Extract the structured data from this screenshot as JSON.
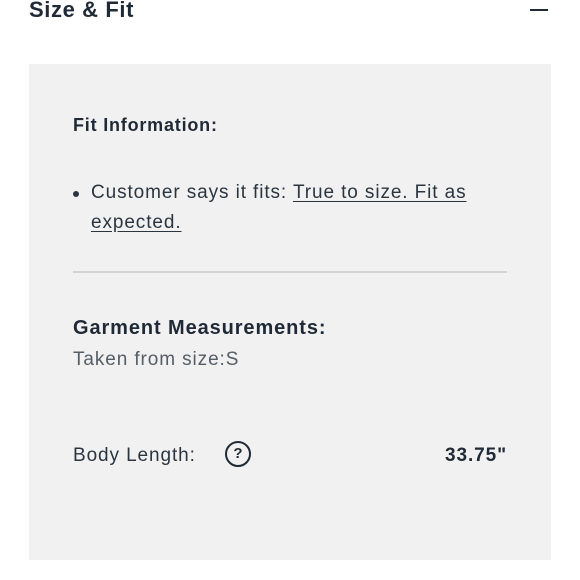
{
  "section": {
    "title": "Size & Fit",
    "collapse_icon": "minus-icon"
  },
  "fit_information": {
    "heading": "Fit Information:",
    "items": [
      {
        "prefix": "Customer says it fits: ",
        "link_text": "True to size. Fit as expected."
      }
    ]
  },
  "garment_measurements": {
    "heading": "Garment Measurements:",
    "subtitle": "Taken from size:S",
    "rows": [
      {
        "label": "Body Length:",
        "help_icon": "question-circle-icon",
        "help_glyph": "?",
        "value": "33.75\""
      }
    ]
  },
  "colors": {
    "text": "#1f2a36",
    "panel_bg": "#f1f1f1",
    "divider": "#d3d3d3"
  }
}
